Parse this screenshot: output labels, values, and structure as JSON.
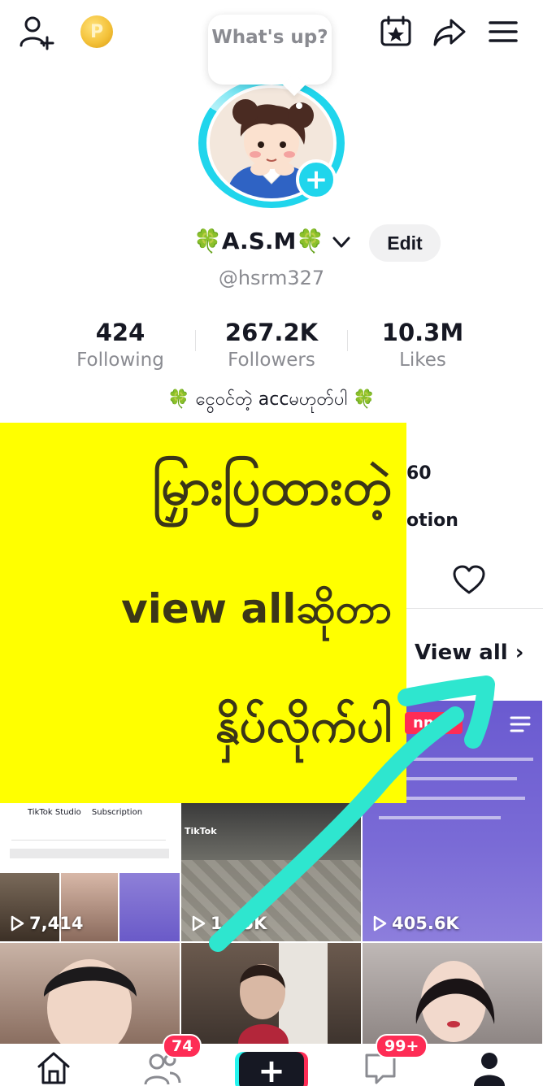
{
  "bubble": {
    "text": "What's up?"
  },
  "profile": {
    "display_name": "🍀A.S.M🍀",
    "handle": "@hsrm327",
    "edit_label": "Edit"
  },
  "stats": [
    {
      "value": "424",
      "label": "Following"
    },
    {
      "value": "267.2K",
      "label": "Followers"
    },
    {
      "value": "10.3M",
      "label": "Likes"
    }
  ],
  "bio": {
    "line1": "🍀 ငွေဝင်တဲ့ accမဟုတ်ပါ 🍀",
    "partial_number": "60",
    "partial_word": "otion"
  },
  "view_all": "View all",
  "overlay": {
    "line1": "မြှားပြထားတဲ့",
    "line2": "view allဆိုတာ",
    "line3": "နှိပ်လိုက်ပါ",
    "color": "#ffff00"
  },
  "pinned_label": "nned",
  "videos": [
    {
      "views": "7,414"
    },
    {
      "views": "1...5K"
    },
    {
      "views": "405.6K"
    }
  ],
  "thumb_text": {
    "studio": "TikTok Studio",
    "subscription": "Subscription",
    "tiktok": "TikTok"
  },
  "nav": {
    "friends_badge": "74",
    "inbox_badge": "99+"
  },
  "colors": {
    "accent_cyan": "#20d5ec",
    "stroke_teal": "#2ee6cf",
    "badge_red": "#fe2c55"
  }
}
